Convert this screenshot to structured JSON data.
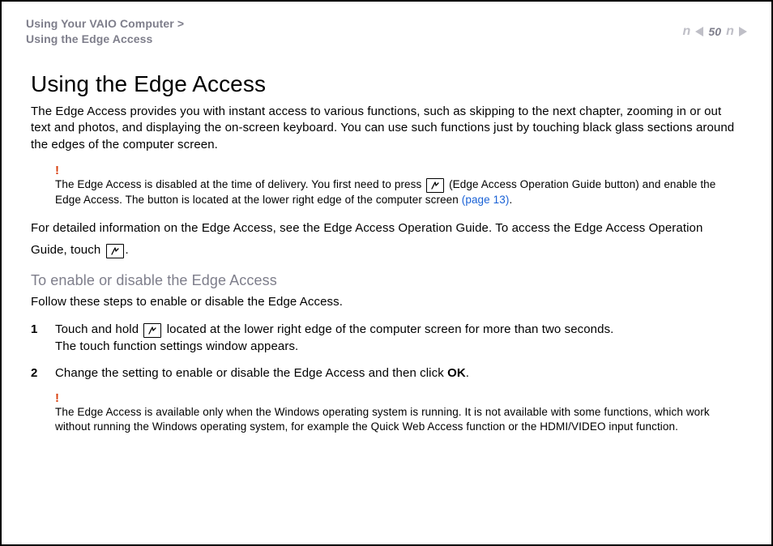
{
  "header": {
    "breadcrumb_line1": "Using Your VAIO Computer >",
    "breadcrumb_line2": "Using the Edge Access",
    "page_number": "50",
    "n_letter": "n"
  },
  "h1": "Using the Edge Access",
  "intro": "The Edge Access provides you with instant access to various functions, such as skipping to the next chapter, zooming in or out text and photos, and displaying the on-screen keyboard. You can use such functions just by touching black glass sections around the edges of the computer screen.",
  "bang_mark": "!",
  "note1_a": "The Edge Access is disabled at the time of delivery. You first need to press ",
  "note1_b": " (Edge Access Operation Guide button) and enable the Edge Access. The button is located at the lower right edge of the computer screen ",
  "note1_link": "(page 13)",
  "note1_c": ".",
  "para2_a": "For detailed information on the Edge Access, see the Edge Access Operation Guide. To access the Edge Access Operation Guide, touch ",
  "para2_b": ".",
  "h2": "To enable or disable the Edge Access",
  "para3": "Follow these steps to enable or disable the Edge Access.",
  "steps": {
    "s1_num": "1",
    "s1_a": "Touch and hold ",
    "s1_b": " located at the lower right edge of the computer screen for more than two seconds.",
    "s1_c": "The touch function settings window appears.",
    "s2_num": "2",
    "s2_a": "Change the setting to enable or disable the Edge Access and then click ",
    "s2_ok": "OK",
    "s2_b": "."
  },
  "note2": "The Edge Access is available only when the Windows operating system is running. It is not available with some functions, which work without running the Windows operating system, for example the Quick Web Access function or the HDMI/VIDEO input function."
}
